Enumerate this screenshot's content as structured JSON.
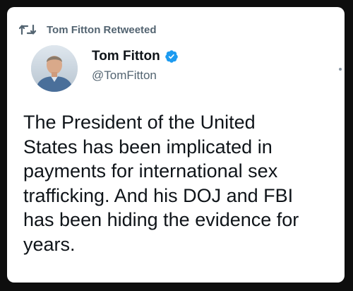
{
  "retweet_header": {
    "icon": "retweet-icon",
    "text": "Tom Fitton Retweeted"
  },
  "author": {
    "avatar": "avatar-photo",
    "display_name": "Tom Fitton",
    "verified_icon": "verified-badge-icon",
    "verified_color": "#1d9bf0",
    "handle": "@TomFitton"
  },
  "tweet": {
    "lines": [
      "The President of the United",
      "States has been implicated in",
      "payments for international sex",
      "trafficking. And his DOJ and FBI",
      "has been hiding the evidence for",
      "years."
    ]
  },
  "colors": {
    "text_primary": "#0f1419",
    "text_secondary": "#536471",
    "background": "#ffffff"
  }
}
